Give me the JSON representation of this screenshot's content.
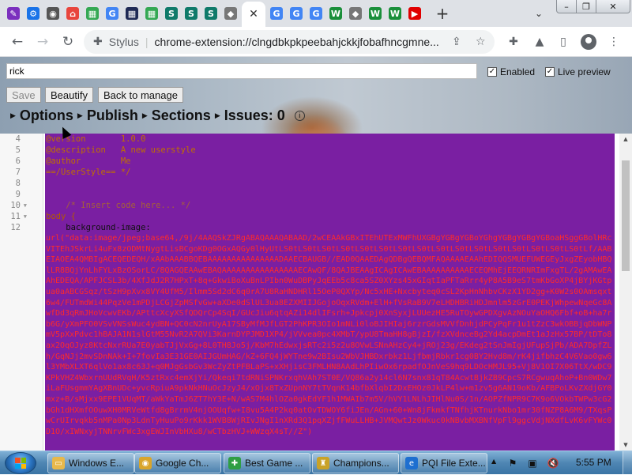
{
  "tabs": {
    "favicons": [
      {
        "icon": "feather-icon",
        "color": "#7b2fbe",
        "glyph": "✎"
      },
      {
        "icon": "gear-icon",
        "color": "#1a73e8",
        "glyph": "⚙"
      },
      {
        "icon": "chrome-icon",
        "color": "#555555",
        "glyph": "◉"
      },
      {
        "icon": "house-icon",
        "color": "#e8453c",
        "glyph": "⌂"
      },
      {
        "icon": "windows-icon",
        "color": "#34a853",
        "glyph": "▦"
      },
      {
        "icon": "google-icon",
        "color": "#4285f4",
        "glyph": "G"
      },
      {
        "icon": "grid-icon",
        "color": "#1f2a55",
        "glyph": "▦"
      },
      {
        "icon": "windows-icon",
        "color": "#34a853",
        "glyph": "▦"
      },
      {
        "icon": "s-icon",
        "color": "#0f7a6a",
        "glyph": "S"
      },
      {
        "icon": "s-icon",
        "color": "#0f7a6a",
        "glyph": "S"
      },
      {
        "icon": "s-icon",
        "color": "#0f7a6a",
        "glyph": "S"
      },
      {
        "icon": "roblox-icon",
        "color": "#777777",
        "glyph": "◆"
      },
      {
        "active": true,
        "icon": "close-icon",
        "glyph": "✕"
      },
      {
        "icon": "google-icon",
        "color": "#4285f4",
        "glyph": "G"
      },
      {
        "icon": "google-icon",
        "color": "#4285f4",
        "glyph": "G"
      },
      {
        "icon": "google-icon",
        "color": "#4285f4",
        "glyph": "G"
      },
      {
        "icon": "w-icon",
        "color": "#1a8f3a",
        "glyph": "W"
      },
      {
        "icon": "roblox-icon",
        "color": "#777777",
        "glyph": "◆"
      },
      {
        "icon": "w-icon",
        "color": "#1a8f3a",
        "glyph": "W"
      },
      {
        "icon": "w-icon",
        "color": "#1a8f3a",
        "glyph": "W"
      },
      {
        "icon": "youtube-icon",
        "color": "#e00000",
        "glyph": "▶"
      }
    ],
    "new_tab": "+",
    "chevron": "⌄",
    "min": "–",
    "max": "❐",
    "close": "✕"
  },
  "toolbar": {
    "back": "←",
    "forward": "→",
    "reload": "↻",
    "site_name": "Stylus",
    "url": "chrome-extension://clngdbkpkpeebahjckkjfobafhncgmne...",
    "share": "⇪",
    "bookmark": "☆",
    "extensions": "✚",
    "flask": "▲",
    "sidepanel": "▯",
    "menu": "⋮"
  },
  "editor_header": {
    "name_value": "rick",
    "enabled_label": "Enabled",
    "live_preview_label": "Live preview",
    "save_label": "Save",
    "beautify_label": "Beautify",
    "back_label": "Back to manage",
    "sections": [
      {
        "label": "Options"
      },
      {
        "label": "Publish"
      },
      {
        "label": "Sections"
      },
      {
        "label": "Issues: 0"
      }
    ],
    "info": "i"
  },
  "code_editor": {
    "line_numbers": [
      "4",
      "5",
      "6",
      "7",
      "8",
      "9",
      "10",
      "11",
      "12"
    ],
    "lines": [
      "@version       1.0.0",
      "@description   A new userstyle",
      "@author        Me",
      "==/UserStyle== */",
      "",
      "",
      "    /* Insert code here... */",
      "body {",
      "    background-image:"
    ],
    "url_value": "url(\"data:image/jpeg;base64,/9j/4AAQSkZJRgABAQAAAQABAAD/2wCEAAkGBxITEhUTExMWFhUXGBgYGBgYGBoYGhgYGBgYGBgYGBoaHSggGBolHRcVITEhJSkrLi4uFx8zODMtNygtLisBCgoKDg0OGxAQGy0lHyUtLS0tLS0tLS0tLS0tLS0tLS0tLS0tLS0tLS0tLS0tLS0tLS0tLS0tLS0tLS0tLS0tLf/AABEIAOEA4QMBIgACEQEDEQH/xAAbAAABBQEBAAAAAAAAAAAAAAADAAECBAUGB//EAD0QAAEDAgQDBgQEBQMFAQAAAAEAAhEDIQQSMUEFUWEGEyJxgZEyobHBQlLR8BQjYnLhFYLxBzOSorLC/8QAGQEAAwEBAQAAAAAAAAAAAAAAAAECAwQF/8QAJBEAAgICAgICAwEBAAAAAAAAAAECEQMhEjEEQRNRImFxgTL/2gAMAwEAAhEDEQA/APFJCSL3b/4XfJdJ2R7HPxT+8q+GkwiBoXuBnLPIbn0WuDBPyJqEEb5c8ca5SZ0XYzs45xGIqtIaPFTaRrr4yP8A5B9eS7tmKbGoXP4jBYjKGtpua0aABCGSqz/tSzH9pXvx8VY4UfM5/Ilmm5Sd2dC6q0rA7U8RaHNDHRl15OeP0QXYp/Nc5xHE+Nxcbyteq0cSL2KpHnNhbvCKzX1YD2gg+K0W2s0OAmsqxt6w4/FUTmdWi44PqzVe1mPDjLCGjZpMSfvGw+aXDe0dSlUL3ua8EZXMIIJGojoOqxRVdm+ElH+fVsRaB9V7eLHDHBRiHDJmnlm5zGrE0PEKjWhpewNqeGc8AwfDd3qRmJHoVcwvEKb/APttcXcyXSfQDQrCp4SqI/GUcJiu6qtqAZi14dlIFsrh+Jpkcpj0XnSyxjLUUezHE5RuTOywGPDXgvAzNOuYaOHQ6Fbf+oB+ha7rb6G/yXmPFO0VSvVNSsWuc4ydBN+QC0cN2nrUyA17SByMfMJfLGT2PhKPR3OIo1mNLi0loBJIHIaj6rzrGdsMVVfDnhjdPCyPqFr1u1tZzC3wkOBBjqDbWNPmV5pXxPdvc1hBAJA1N1slGtM55NvR2A7QVi3KarnDYPJMD1XP4/jVVvea0pc4XMbT/ypU8TmaHH8gBjzI/fzXVdnceBg2Yd4acpDmEt1aJzHx57BP/tDTo8ax2OqOJyz8KtcNxrRUa7E0yabTJjVxGg+8L0TH8Jo5j/KbM7hEdwxjsRTc2i5z2u8OVwLSNnAHzCy4+jROj23g/EKdeg2tSnJmIgjUFupSjPb/ADA7DpfZLh/GqNJj2mvSDnNAk+I+7fovIa3E31GE0AIJGUmHAG/kZ+6FQ4jWYTne9w2BIsu2WbVJHBDxrbkz1LjfbmjRbkr1cg0BY2Hvd8m/rK4jifbhzC4V6Vao0gw6l3YMbXLXT6qlVo1ax8c63J+q0MJgGsbGv3WcZyZtPFBLaPS+xXHjisC3FMLHN8AAdLhPIiwOx6rpadfOJnVeS9hq9LDOcHMJL95+Vj8V1OI7X06TtX/wDC9KPkVHZ4WbxrnUUdRVqH/K5ztRxc4emXjYi/Qkeqi7tdRNiSPNKrxqhVAh7ST0E/VQ86a2y14cl6N7snx81qT84AcwtBjkZB9CpcS7RCgwuqAhoP+Bn0WDw7iLaFUsgmmYAgXBnUDc+yvcRpiuA9pkNkHNuOcJzyJ4/xOjx8TxZUpnNY7tTVqnK14bfbXlqbI2DxEHOz0JkLP4lw+m1zv5g6AN19oKb/AFBPoLKvZXdjGY0mxz+B/sMjxx9EPE1VUqMT/aWkYaTmJ6ZT7hY3E+N/wAS7M4hlOZa0gkEdYF1h1MWAIb7m5V/hVY1LNLhJIHlNu0S/1n/AOPZfNPR9C7K9o6VOkbTWPw3cG2bGh1dHXmfOOuwXH0MRVeWtfd8gBrrmV4njOOUqfw+I8vu5A4P2kq0atOvTDWOY6fiJEn/AGn+60+Wn8jFkmkfTNfhjKTnurkNbo1mr30fNZP8A6M9/TXqsPwCrUIrvqkb5nMPa0Np3LdnTyHuuPo9rKkk1WVB8WjRIvJNgI1nXRd3Q1pqXZjfFWuLLHB+JVMQwtJz0Wkuc0kNBvbMXBNfVpFl9ggcVdjNXdfLvK6vFYWc0D1O/xIWNxyjTNNrvFWc3xgEWJInVbHXu8/wCTbzHVJ+WWzqX4sT//Z\")"
  },
  "taskbar": {
    "items": [
      {
        "label": "Windows E...",
        "icon": "folder-icon",
        "color": "#e8b84b",
        "glyph": "▭"
      },
      {
        "label": "Google Ch...",
        "icon": "chrome-icon",
        "color": "#d9a52b",
        "glyph": "◉"
      },
      {
        "label": "Best Game ...",
        "icon": "puzzle-icon",
        "color": "#2f9e44",
        "glyph": "✚"
      },
      {
        "label": "Champions...",
        "icon": "trophy-icon",
        "color": "#c9a227",
        "glyph": "♜"
      },
      {
        "label": "PQI File Exte...",
        "icon": "ie-icon",
        "color": "#1e6fd0",
        "glyph": "e"
      }
    ],
    "tray_up": "▲",
    "clock": "5:55 PM"
  }
}
